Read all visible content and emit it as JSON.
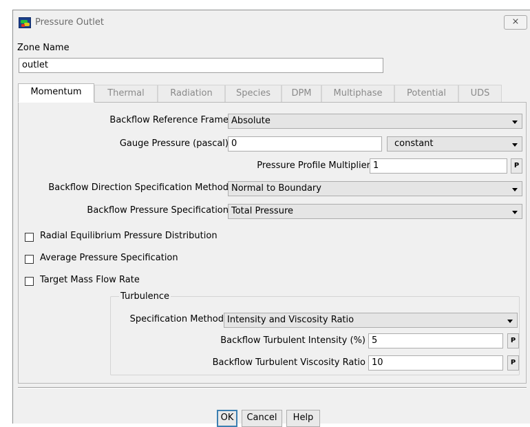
{
  "window": {
    "title": "Pressure Outlet",
    "close_label": "⨯"
  },
  "zone": {
    "label": "Zone Name",
    "value": "outlet"
  },
  "tabs": [
    {
      "label": "Momentum",
      "active": true
    },
    {
      "label": "Thermal"
    },
    {
      "label": "Radiation"
    },
    {
      "label": "Species"
    },
    {
      "label": "DPM"
    },
    {
      "label": "Multiphase"
    },
    {
      "label": "Potential"
    },
    {
      "label": "UDS"
    }
  ],
  "momentum": {
    "backflow_ref_frame": {
      "label": "Backflow Reference Frame",
      "value": "Absolute"
    },
    "gauge_pressure": {
      "label": "Gauge Pressure (pascal)",
      "value": "0",
      "method": "constant"
    },
    "pressure_profile_multiplier": {
      "label": "Pressure Profile Multiplier",
      "value": "1",
      "param": "P"
    },
    "backflow_direction": {
      "label": "Backflow Direction Specification Method",
      "value": "Normal to Boundary"
    },
    "backflow_pressure": {
      "label": "Backflow Pressure Specification",
      "value": "Total Pressure"
    },
    "checkboxes": [
      {
        "label": "Radial Equilibrium Pressure Distribution",
        "checked": false
      },
      {
        "label": "Average Pressure Specification",
        "checked": false
      },
      {
        "label": "Target Mass Flow Rate",
        "checked": false
      }
    ],
    "turbulence": {
      "title": "Turbulence",
      "spec_method": {
        "label": "Specification Method",
        "value": "Intensity and Viscosity Ratio"
      },
      "intensity": {
        "label": "Backflow Turbulent Intensity (%)",
        "value": "5",
        "param": "P"
      },
      "viscosity_ratio": {
        "label": "Backflow Turbulent Viscosity Ratio",
        "value": "10",
        "param": "P"
      }
    }
  },
  "buttons": {
    "ok": "OK",
    "cancel": "Cancel",
    "help": "Help"
  },
  "colors": {
    "dialog_bg": "#f0f0f0",
    "default_button_border": "#3c7fb1"
  }
}
